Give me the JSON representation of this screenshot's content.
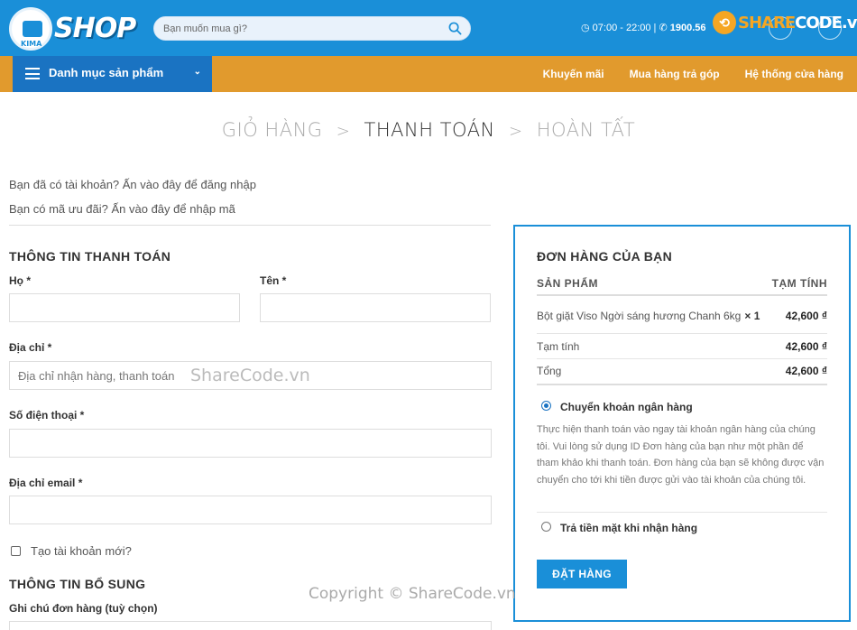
{
  "header": {
    "logo_text": "SHOP",
    "logo_subtext": "KIMA",
    "search_placeholder": "Bạn muốn mua gì?",
    "hours": "07:00 - 22:00 |",
    "phone": "1900.56",
    "brand_color": "#1a8fd8"
  },
  "watermark": {
    "logo_share": "SHARE",
    "logo_code": "CODE.vn",
    "middle": "ShareCode.vn",
    "bottom": "Copyright © ShareCode.vn"
  },
  "nav": {
    "category_label": "Danh mục sản phẩm",
    "links": [
      "Khuyến mãi",
      "Mua hàng trả góp",
      "Hệ thống cửa hàng"
    ],
    "nav_color": "#e19a2d",
    "category_color": "#1a73c2"
  },
  "steps": {
    "cart": "GIỎ HÀNG",
    "checkout": "THANH TOÁN",
    "done": "HOÀN TẤT",
    "separator": ">"
  },
  "notices": {
    "login": "Bạn đã có tài khoản? Ấn vào đây để đăng nhập",
    "coupon": "Bạn có mã ưu đãi? Ấn vào đây để nhập mã"
  },
  "billing": {
    "title": "THÔNG TIN THANH TOÁN",
    "last_name_label": "Họ *",
    "first_name_label": "Tên *",
    "address_label": "Địa chỉ *",
    "address_placeholder": "Địa chỉ nhận hàng, thanh toán",
    "phone_label": "Số điện thoại *",
    "email_label": "Địa chỉ email *",
    "create_account_label": "Tạo tài khoản mới?"
  },
  "additional": {
    "title": "THÔNG TIN BỔ SUNG",
    "notes_label": "Ghi chú đơn hàng (tuỳ chọn)"
  },
  "order": {
    "title": "ĐƠN HÀNG CỦA BẠN",
    "col_product": "SẢN PHẨM",
    "col_subtotal": "TẠM TÍNH",
    "item_name": "Bột giặt Viso Ngời sáng hương Chanh 6kg",
    "item_qty": "× 1",
    "item_price": "42,600 ₫",
    "subtotal_label": "Tạm tính",
    "subtotal_value": "42,600 ₫",
    "total_label": "Tổng",
    "total_value": "42,600 ₫",
    "payment_bank_label": "Chuyển khoản ngân hàng",
    "payment_bank_desc": "Thực hiện thanh toán vào ngay tài khoản ngân hàng của chúng tôi. Vui lòng sử dụng ID Đơn hàng của bạn như một phần để tham khảo khi thanh toán. Đơn hàng của bạn sẽ không được vận chuyển cho tới khi tiền được gửi vào tài khoản của chúng tôi.",
    "payment_cod_label": "Trả tiền mặt khi nhận hàng",
    "place_order": "ĐẶT HÀNG"
  }
}
